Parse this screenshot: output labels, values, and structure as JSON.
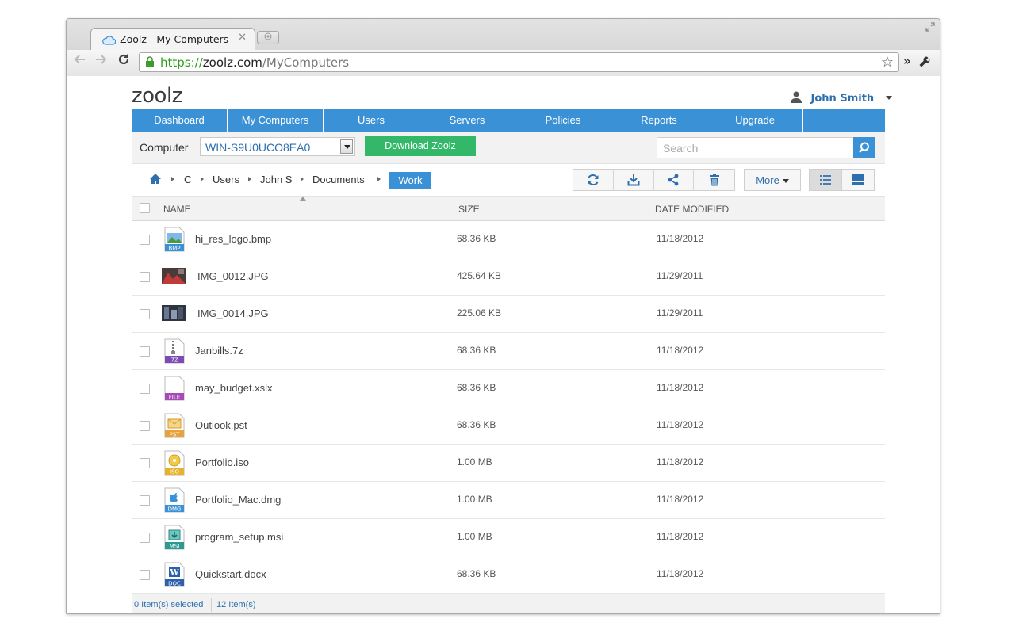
{
  "browser": {
    "tab_title": "Zoolz - My Computers",
    "tab_close": "✕",
    "url_scheme": "https://",
    "url_domain": "zoolz.com",
    "url_path": "/MyComputers"
  },
  "app": {
    "logo": "zoolz",
    "user_name": "John Smith"
  },
  "nav": {
    "items": [
      "Dashboard",
      "My Computers",
      "Users",
      "Servers",
      "Policies",
      "Reports",
      "Upgrade"
    ]
  },
  "filter": {
    "computer_label": "Computer",
    "computer_value": "WIN-S9U0UCO8EA0",
    "download_label": "Download Zoolz",
    "search_placeholder": "Search"
  },
  "breadcrumb": {
    "items": [
      "C",
      "Users",
      "John S",
      "Documents"
    ],
    "active": "Work"
  },
  "toolbar": {
    "more_label": "More"
  },
  "table": {
    "headers": {
      "name": "NAME",
      "size": "SIZE",
      "date": "DATE MODIFIED"
    },
    "rows": [
      {
        "name": "hi_res_logo.bmp",
        "size": "68.36 KB",
        "date": "11/18/2012",
        "icon": "bmp-file-icon",
        "badge": "BMP"
      },
      {
        "name": "IMG_0012.JPG",
        "size": "425.64 KB",
        "date": "11/29/2011",
        "icon": "photo-thumbnail-icon",
        "badge": ""
      },
      {
        "name": "IMG_0014.JPG",
        "size": "225.06 KB",
        "date": "11/29/2011",
        "icon": "photo-thumbnail-icon",
        "badge": ""
      },
      {
        "name": "Janbills.7z",
        "size": "68.36 KB",
        "date": "11/18/2012",
        "icon": "archive-file-icon",
        "badge": "7Z"
      },
      {
        "name": "may_budget.xslx",
        "size": "68.36 KB",
        "date": "11/18/2012",
        "icon": "generic-file-icon",
        "badge": "FILE"
      },
      {
        "name": "Outlook.pst",
        "size": "68.36 KB",
        "date": "11/18/2012",
        "icon": "mail-file-icon",
        "badge": "PST"
      },
      {
        "name": "Portfolio.iso",
        "size": "1.00 MB",
        "date": "11/18/2012",
        "icon": "disc-image-icon",
        "badge": "ISO"
      },
      {
        "name": "Portfolio_Mac.dmg",
        "size": "1.00 MB",
        "date": "11/18/2012",
        "icon": "mac-dmg-icon",
        "badge": "DMG"
      },
      {
        "name": "program_setup.msi",
        "size": "1.00 MB",
        "date": "11/18/2012",
        "icon": "installer-file-icon",
        "badge": "MSI"
      },
      {
        "name": "Quickstart.docx",
        "size": "68.36 KB",
        "date": "11/18/2012",
        "icon": "word-document-icon",
        "badge": "DOC"
      }
    ]
  },
  "status": {
    "selected": "0 Item(s) selected",
    "total": "12 Item(s)"
  },
  "colors": {
    "brand_blue": "#3a91d6",
    "download_green": "#33b86a",
    "link_blue": "#2e6fad"
  }
}
